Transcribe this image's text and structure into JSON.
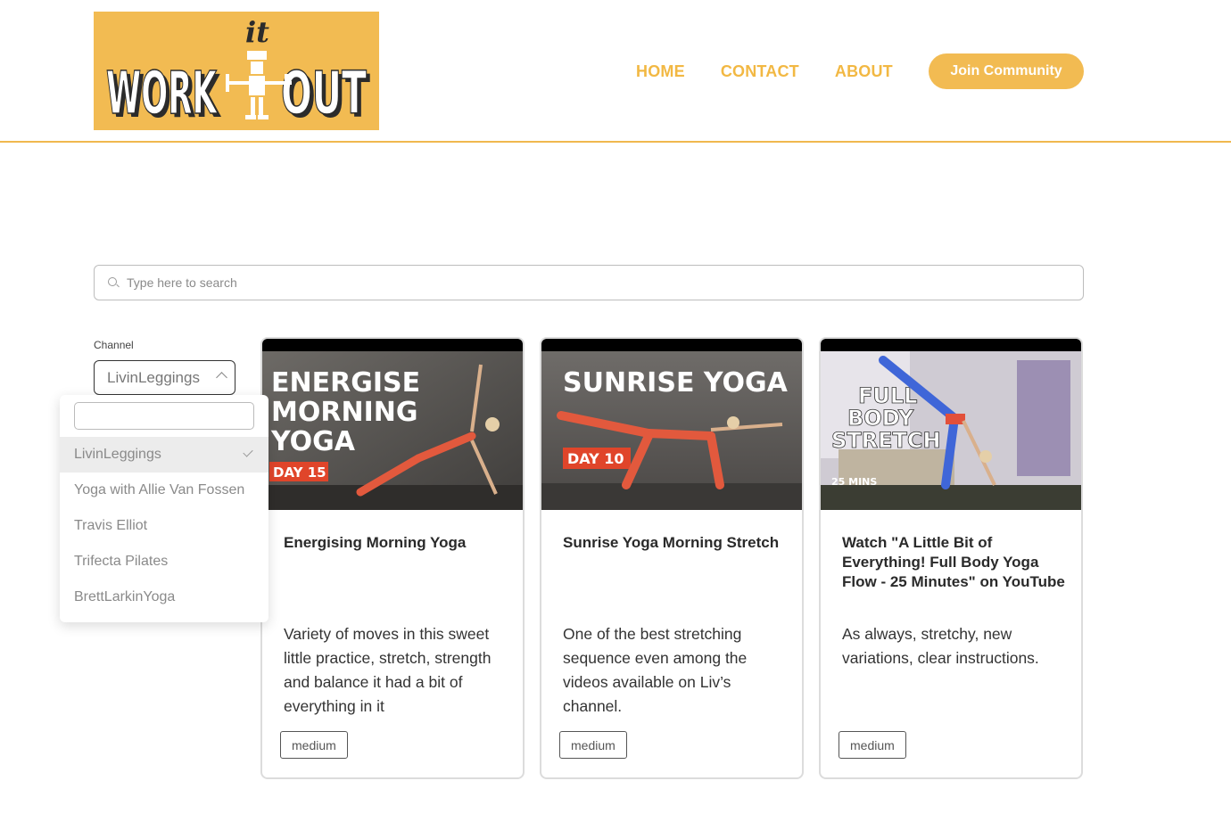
{
  "brand": {
    "logo_small": "it",
    "logo_left": "WORK",
    "logo_right": "OUT",
    "colors": {
      "accent": "#f2bb52",
      "nav": "#f2b843"
    }
  },
  "nav": {
    "items": [
      "HOME",
      "CONTACT",
      "ABOUT"
    ],
    "join_label": "Join Community"
  },
  "search": {
    "placeholder": "Type here to search",
    "icon": "search-icon"
  },
  "filter": {
    "label": "Channel",
    "selected": "LivinLeggings",
    "options": [
      "LivinLeggings",
      "Yoga with Allie Van Fossen",
      "Travis Elliot",
      "Trifecta Pilates",
      "BrettLarkinYoga"
    ]
  },
  "cards": [
    {
      "thumb_lines": [
        "ENERGISE",
        "MORNING",
        "YOGA"
      ],
      "thumb_badge": "DAY 15",
      "title": "Energising Morning Yoga",
      "description": "Variety of moves in this sweet little practice, stretch, strength and balance it had a bit of everything in it",
      "tag": "medium"
    },
    {
      "thumb_lines": [
        "SUNRISE YOGA"
      ],
      "thumb_badge": "DAY 10",
      "title": "Sunrise Yoga Morning Stretch",
      "description": "One of the best stretching sequence even among the videos available on Liv’s channel.",
      "tag": "medium"
    },
    {
      "thumb_lines": [
        "FULL",
        "BODY",
        "STRETCH"
      ],
      "thumb_badge": "25 MINS",
      "title": "Watch \"A Little Bit of Everything! Full Body Yoga Flow - 25 Minutes\" on YouTube",
      "description": "As always, stretchy, new variations, clear instructions.",
      "tag": "medium"
    }
  ]
}
